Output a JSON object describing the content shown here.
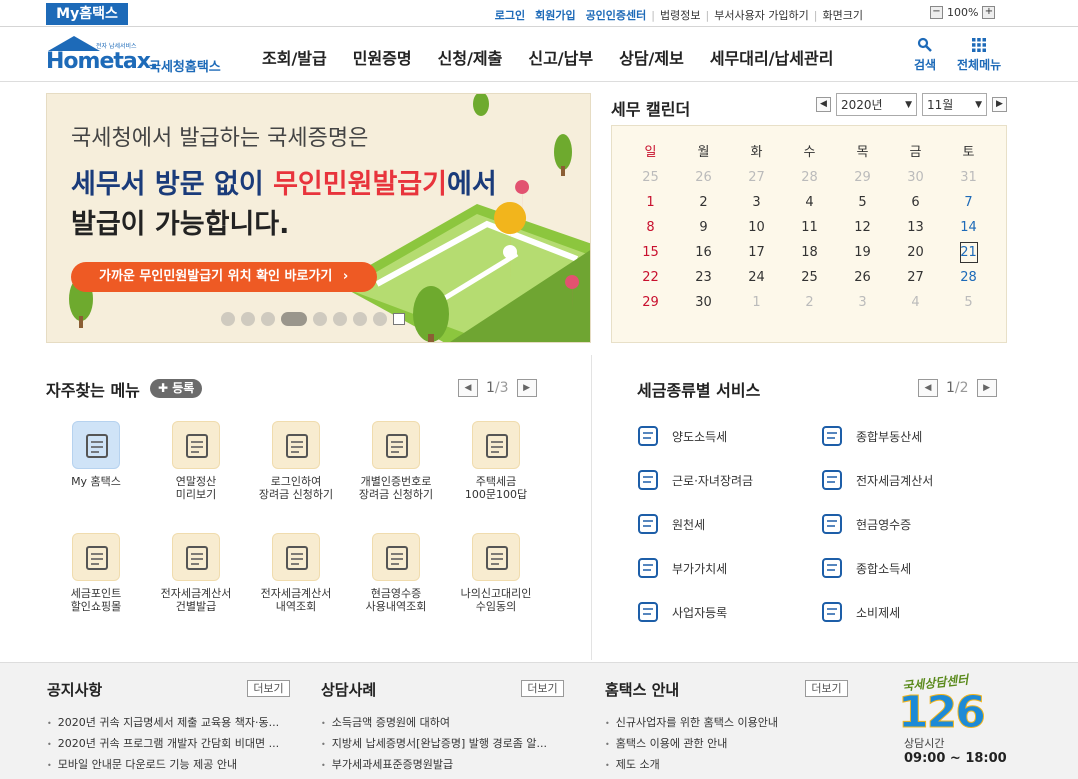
{
  "topbar": {
    "my_tab": "My홈택스",
    "links": [
      "로그인",
      "회원가입",
      "공인인증센터",
      "법령정보",
      "부서사용자 가입하기",
      "화면크기"
    ],
    "zoom": "100%"
  },
  "header": {
    "logo_small": "전자 납세서비스",
    "logo_main": "Hometax.",
    "logo_sub": "국세청홈택스",
    "nav": [
      "조회/발급",
      "민원증명",
      "신청/제출",
      "신고/납부",
      "상담/제보",
      "세무대리/납세관리"
    ],
    "search_label": "검색",
    "allmenu_label": "전체메뉴"
  },
  "banner": {
    "line1": "국세청에서 발급하는 국세증명은",
    "line2a": "세무서 방문 없이 ",
    "line2b": "무인민원발급기",
    "line2c": "에서",
    "line3": "발급이 가능합니다.",
    "button": "가까운 무인민원발급기 위치 확인 바로가기",
    "slides": 8,
    "active_slide": 4
  },
  "calendar": {
    "title": "세무 캘린더",
    "year": "2020년",
    "month": "11월",
    "weekdays": [
      "일",
      "월",
      "화",
      "수",
      "목",
      "금",
      "토"
    ],
    "weeks": [
      [
        "25",
        "26",
        "27",
        "28",
        "29",
        "30",
        "31"
      ],
      [
        "1",
        "2",
        "3",
        "4",
        "5",
        "6",
        "7"
      ],
      [
        "8",
        "9",
        "10",
        "11",
        "12",
        "13",
        "14"
      ],
      [
        "15",
        "16",
        "17",
        "18",
        "19",
        "20",
        "21"
      ],
      [
        "22",
        "23",
        "24",
        "25",
        "26",
        "27",
        "28"
      ],
      [
        "29",
        "30",
        "1",
        "2",
        "3",
        "4",
        "5"
      ]
    ],
    "today": "21"
  },
  "freq": {
    "title": "자주찾는 메뉴",
    "register": "등록",
    "page": "1",
    "total": "/3",
    "items": [
      {
        "l1": "My 홈택스",
        "l2": ""
      },
      {
        "l1": "연말정산",
        "l2": "미리보기"
      },
      {
        "l1": "로그인하여",
        "l2": "장려금 신청하기"
      },
      {
        "l1": "개별인증번호로",
        "l2": "장려금 신청하기"
      },
      {
        "l1": "주택세금",
        "l2": "100문100답"
      },
      {
        "l1": "세금포인트",
        "l2": "할인쇼핑몰"
      },
      {
        "l1": "전자세금계산서",
        "l2": "건별발급"
      },
      {
        "l1": "전자세금계산서",
        "l2": "내역조회"
      },
      {
        "l1": "현금영수증",
        "l2": "사용내역조회"
      },
      {
        "l1": "나의신고대리인",
        "l2": "수임동의"
      }
    ]
  },
  "taxsvc": {
    "title": "세금종류별 서비스",
    "page": "1",
    "total": "/2",
    "left": [
      "양도소득세",
      "근로·자녀장려금",
      "원천세",
      "부가가치세",
      "사업자등록"
    ],
    "right": [
      "종합부동산세",
      "전자세금계산서",
      "현금영수증",
      "종합소득세",
      "소비제세"
    ]
  },
  "footer": {
    "more": "더보기",
    "notice": {
      "title": "공지사항",
      "items": [
        "2020년 귀속 지급명세서 제출 교육용 책자·동...",
        "2020년 귀속 프로그램 개발자 간담회 비대면 ...",
        "모바일 안내문 다운로드 기능 제공 안내"
      ]
    },
    "consult": {
      "title": "상담사례",
      "items": [
        "소득금액 증명원에 대하여",
        "지방세 납세증명서[완납증명] 발행 경로좀 알...",
        "부가세과세표준증명원발급"
      ]
    },
    "guide": {
      "title": "홈택스 안내",
      "items": [
        "신규사업자를 위한 홈택스 이용안내",
        "홈택스 이용에 관한 안내",
        "제도 소개"
      ]
    },
    "center": {
      "title": "국세상담센터",
      "number": "126",
      "hours_label": "상담시간",
      "hours": "09:00 ~ 18:00"
    }
  }
}
